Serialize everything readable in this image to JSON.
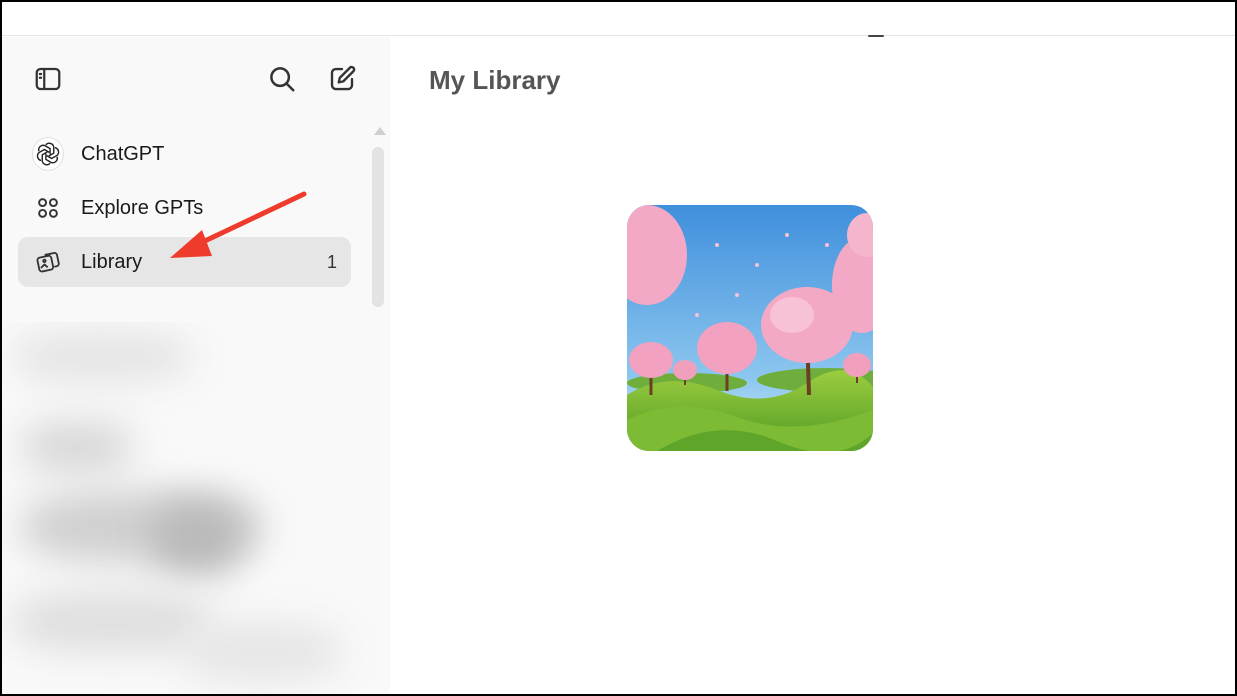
{
  "sidebar": {
    "icons": {
      "toggle": "sidebar-toggle-icon",
      "search": "search-icon",
      "new_chat": "compose-icon"
    },
    "items": [
      {
        "label": "ChatGPT",
        "icon": "openai-logo-icon",
        "count": ""
      },
      {
        "label": "Explore GPTs",
        "icon": "grid-dots-icon",
        "count": ""
      },
      {
        "label": "Library",
        "icon": "images-icon",
        "count": "1",
        "active": true
      }
    ]
  },
  "main": {
    "title": "My Library",
    "images": [
      {
        "subject": "cherry-blossom-landscape"
      }
    ]
  },
  "colors": {
    "annotation_arrow": "#ef3b2c",
    "sidebar_bg": "#f9f9f9",
    "active_item_bg": "#e6e6e6"
  }
}
